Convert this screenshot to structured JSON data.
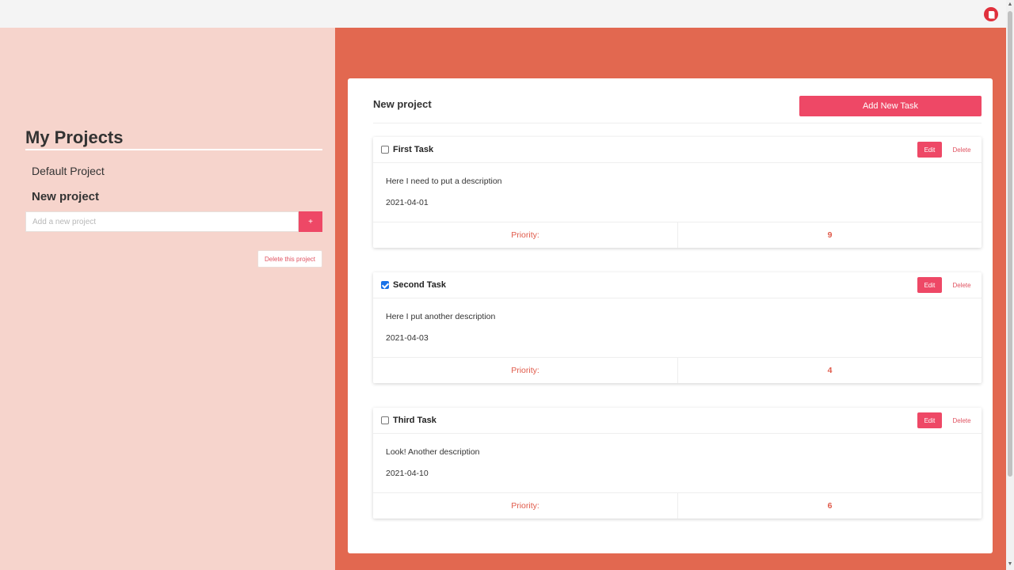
{
  "browser": {
    "extension_icon": "clipboard-icon"
  },
  "sidebar": {
    "title": "My Projects",
    "projects": [
      {
        "name": "Default Project",
        "active": false
      },
      {
        "name": "New project",
        "active": true
      }
    ],
    "add_project": {
      "placeholder": "Add a new project",
      "value": "",
      "button_label": "+"
    },
    "delete_project_label": "Delete this project"
  },
  "main": {
    "project_title": "New project",
    "add_task_label": "Add New Task",
    "tasks": [
      {
        "name": "First Task",
        "completed": false,
        "description": "Here I need to put a description",
        "date": "2021-04-01",
        "priority_label": "Priority:",
        "priority": "9",
        "edit_label": "Edit",
        "delete_label": "Delete"
      },
      {
        "name": "Second Task",
        "completed": true,
        "description": "Here I put another description",
        "date": "2021-04-03",
        "priority_label": "Priority:",
        "priority": "4",
        "edit_label": "Edit",
        "delete_label": "Delete"
      },
      {
        "name": "Third Task",
        "completed": false,
        "description": "Look! Another description",
        "date": "2021-04-10",
        "priority_label": "Priority:",
        "priority": "6",
        "edit_label": "Edit",
        "delete_label": "Delete"
      }
    ]
  },
  "colors": {
    "accent": "#ee4866",
    "sidebar_bg": "#f6d4cc",
    "main_bg": "#e26850",
    "priority_text": "#e05a4a"
  }
}
